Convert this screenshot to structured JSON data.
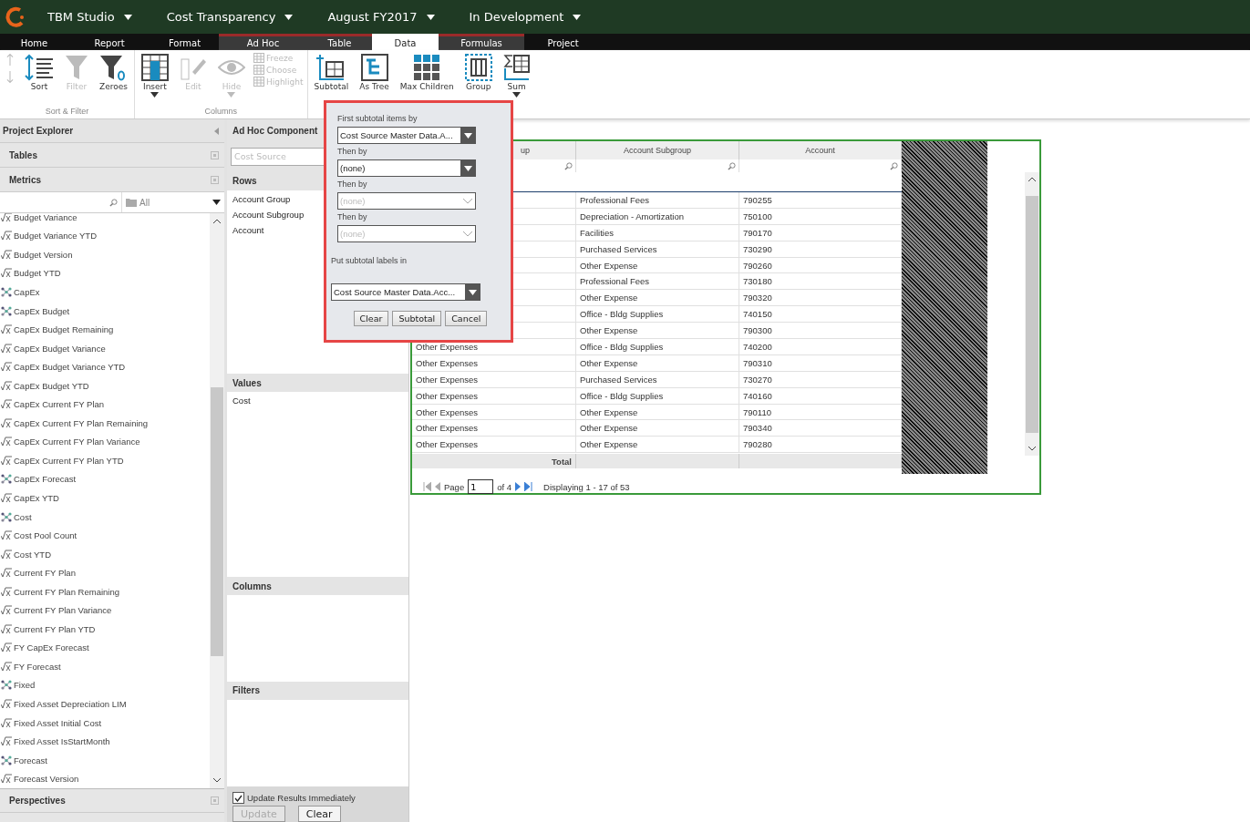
{
  "topbar": {
    "menus": [
      "TBM Studio",
      "Cost Transparency",
      "August FY2017",
      "In Development"
    ]
  },
  "tabs": [
    {
      "label": "Home",
      "selected": false,
      "contextual": false
    },
    {
      "label": "Report",
      "selected": false,
      "contextual": false
    },
    {
      "label": "Format",
      "selected": false,
      "contextual": false
    },
    {
      "label": "Ad Hoc",
      "selected": false,
      "contextual": true
    },
    {
      "label": "Table",
      "selected": false,
      "contextual": true
    },
    {
      "label": "Data",
      "selected": true,
      "contextual": true
    },
    {
      "label": "Formulas",
      "selected": false,
      "contextual": true
    },
    {
      "label": "Project",
      "selected": false,
      "contextual": false
    }
  ],
  "ribbon": {
    "groups": [
      {
        "label": "Sort & Filter",
        "tools": [
          {
            "kind": "sortarrows",
            "disabled": true
          },
          {
            "kind": "sort",
            "label": "Sort",
            "disabled": false
          },
          {
            "kind": "filter",
            "label": "Filter",
            "disabled": true
          },
          {
            "kind": "zeroes",
            "label": "Zeroes",
            "disabled": false
          }
        ]
      },
      {
        "label": "Columns",
        "tools": [
          {
            "kind": "insert",
            "label": "Insert",
            "disabled": false
          },
          {
            "kind": "edit",
            "label": "Edit",
            "disabled": true
          },
          {
            "kind": "hide",
            "label": "Hide",
            "disabled": true
          },
          {
            "kind": "small",
            "disabled": true,
            "items": [
              "Freeze",
              "Choose",
              "Highlight"
            ]
          }
        ]
      },
      {
        "tools": [
          {
            "kind": "subtotal",
            "label": "Subtotal",
            "disabled": false
          },
          {
            "kind": "astree",
            "label": "As Tree",
            "disabled": false
          },
          {
            "kind": "maxchildren",
            "label": "Max Children",
            "disabled": false
          },
          {
            "kind": "group",
            "label": "Group",
            "disabled": false
          },
          {
            "kind": "sum",
            "label": "Sum",
            "disabled": false
          }
        ]
      }
    ]
  },
  "explorer": {
    "title": "Project Explorer",
    "sections": [
      "Tables",
      "Metrics"
    ],
    "filter": "All",
    "metrics": [
      {
        "label": "Budget Variance",
        "kind": "formula"
      },
      {
        "label": "Budget Variance YTD",
        "kind": "formula"
      },
      {
        "label": "Budget Version",
        "kind": "formula"
      },
      {
        "label": "Budget YTD",
        "kind": "formula"
      },
      {
        "label": "CapEx",
        "kind": "cube"
      },
      {
        "label": "CapEx Budget",
        "kind": "cube"
      },
      {
        "label": "CapEx Budget Remaining",
        "kind": "formula"
      },
      {
        "label": "CapEx Budget Variance",
        "kind": "formula"
      },
      {
        "label": "CapEx Budget Variance YTD",
        "kind": "formula"
      },
      {
        "label": "CapEx Budget YTD",
        "kind": "formula"
      },
      {
        "label": "CapEx Current FY Plan",
        "kind": "formula"
      },
      {
        "label": "CapEx Current FY Plan Remaining",
        "kind": "formula"
      },
      {
        "label": "CapEx Current FY Plan Variance",
        "kind": "formula"
      },
      {
        "label": "CapEx Current FY Plan YTD",
        "kind": "formula"
      },
      {
        "label": "CapEx Forecast",
        "kind": "cube"
      },
      {
        "label": "CapEx YTD",
        "kind": "formula"
      },
      {
        "label": "Cost",
        "kind": "cube"
      },
      {
        "label": "Cost Pool Count",
        "kind": "formula"
      },
      {
        "label": "Cost YTD",
        "kind": "formula"
      },
      {
        "label": "Current FY Plan",
        "kind": "formula"
      },
      {
        "label": "Current FY Plan Remaining",
        "kind": "formula"
      },
      {
        "label": "Current FY Plan Variance",
        "kind": "formula"
      },
      {
        "label": "Current FY Plan YTD",
        "kind": "formula"
      },
      {
        "label": "FY CapEx Forecast",
        "kind": "formula"
      },
      {
        "label": "FY Forecast",
        "kind": "formula"
      },
      {
        "label": "Fixed",
        "kind": "cube"
      },
      {
        "label": "Fixed Asset Depreciation LIM",
        "kind": "formula"
      },
      {
        "label": "Fixed Asset Initial Cost",
        "kind": "formula"
      },
      {
        "label": "Fixed Asset IsStartMonth",
        "kind": "formula"
      },
      {
        "label": "Forecast",
        "kind": "cube"
      },
      {
        "label": "Forecast Version",
        "kind": "formula"
      }
    ],
    "bottom_sections": [
      "Perspectives"
    ]
  },
  "component": {
    "title": "Ad Hoc Component",
    "source_placeholder": "Cost Source",
    "rows_title": "Rows",
    "rows": [
      "Account Group",
      "Account Subgroup",
      "Account"
    ],
    "values_title": "Values",
    "values": [
      "Cost"
    ],
    "columns_title": "Columns",
    "filters_title": "Filters",
    "update_immediately": {
      "label": "Update Results Immediately",
      "checked": true
    },
    "buttons": [
      {
        "label": "Update",
        "disabled": true
      },
      {
        "label": "Clear",
        "disabled": false
      }
    ]
  },
  "subtotal_dialog": {
    "first_label": "First subtotal items by",
    "selects": [
      {
        "value": "Cost Source Master Data.A...",
        "disabled": false
      },
      {
        "label": "Then by",
        "value": "(none)",
        "disabled": false
      },
      {
        "label": "Then by",
        "placeholder": "(none)",
        "disabled": true
      },
      {
        "label": "Then by",
        "placeholder": "(none)",
        "disabled": true
      }
    ],
    "labels_in": "Put subtotal labels in",
    "labels_value": "Cost Source Master Data.Acc...",
    "buttons": [
      "Clear",
      "Subtotal",
      "Cancel"
    ]
  },
  "table": {
    "columns": [
      "up",
      "Account Subgroup",
      "Account"
    ],
    "rows": [
      [
        null,
        "Professional Fees",
        "790255"
      ],
      [
        null,
        "Depreciation - Amortization",
        "750100"
      ],
      [
        null,
        "Facilities",
        "790170"
      ],
      [
        null,
        "Purchased Services",
        "730290"
      ],
      [
        null,
        "Other Expense",
        "790260"
      ],
      [
        null,
        "Professional Fees",
        "730180"
      ],
      [
        null,
        "Other Expense",
        "790320"
      ],
      [
        null,
        "Office - Bldg Supplies",
        "740150"
      ],
      [
        null,
        "Other Expense",
        "790300"
      ],
      [
        "Other Expenses",
        "Office - Bldg Supplies",
        "740200"
      ],
      [
        "Other Expenses",
        "Other Expense",
        "790310"
      ],
      [
        "Other Expenses",
        "Purchased Services",
        "730270"
      ],
      [
        "Other Expenses",
        "Office - Bldg Supplies",
        "740160"
      ],
      [
        "Other Expenses",
        "Other Expense",
        "790110"
      ],
      [
        "Other Expenses",
        "Other Expense",
        "790340"
      ],
      [
        "Other Expenses",
        "Other Expense",
        "790280"
      ]
    ],
    "total_label": "Total",
    "pager": {
      "page_label": "Page",
      "page": "1",
      "of": "of 4",
      "display": "Displaying 1 - 17 of 53"
    }
  }
}
